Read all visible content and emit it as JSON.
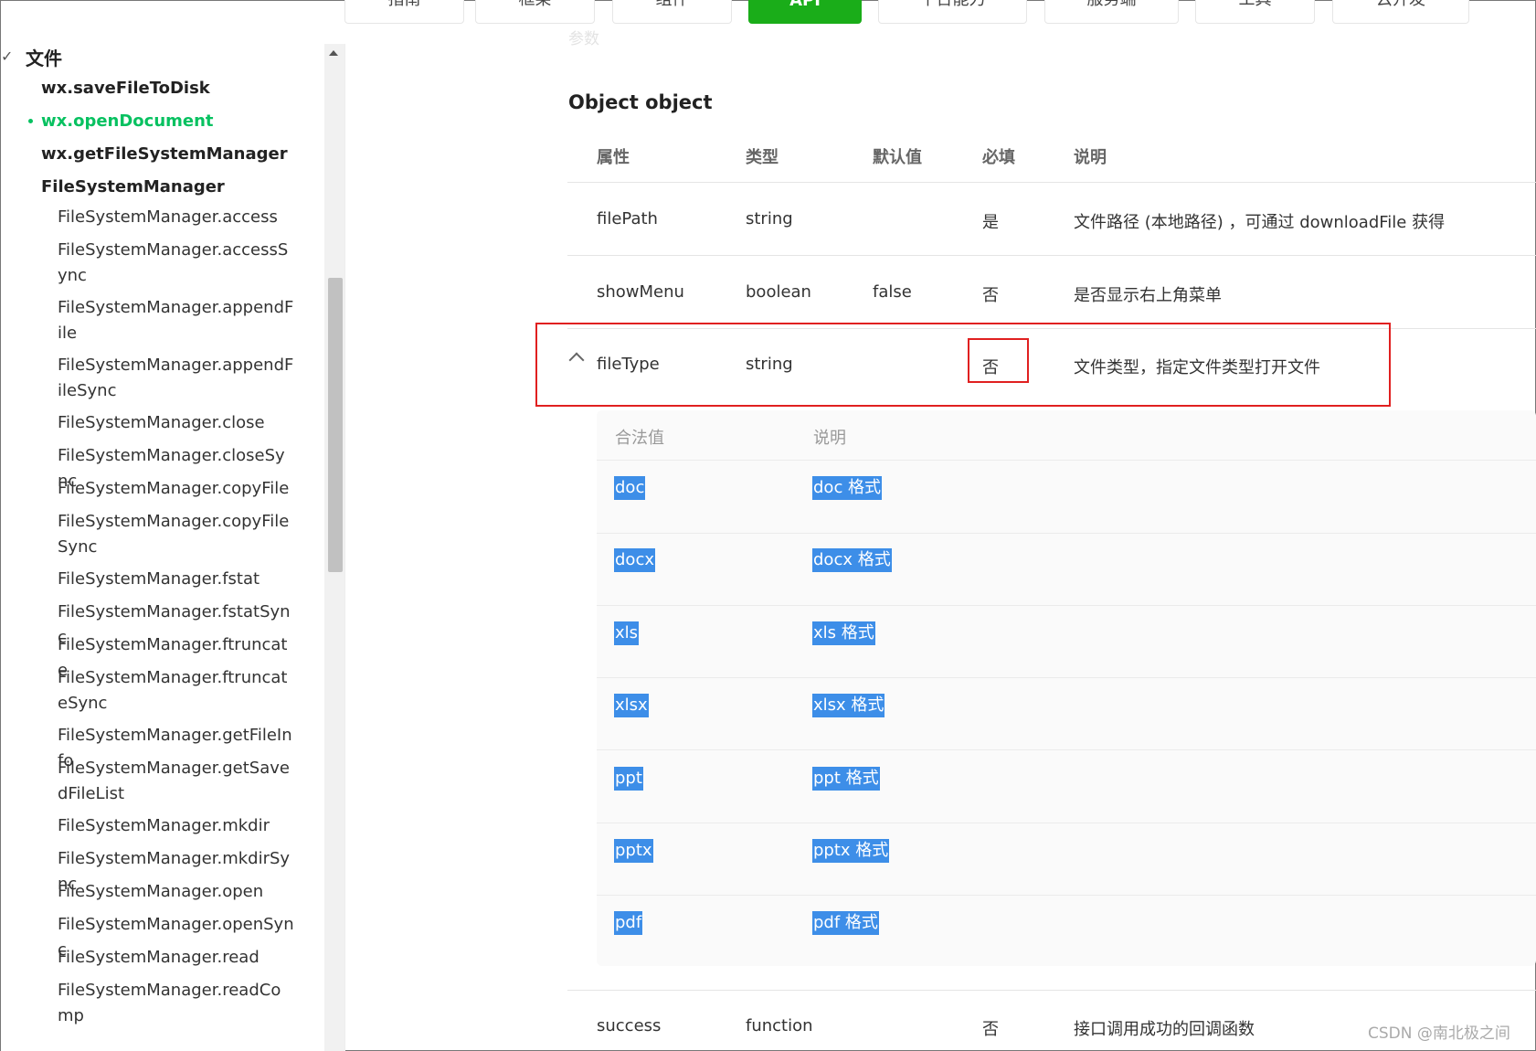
{
  "nav": {
    "tabs": [
      {
        "label": "指南"
      },
      {
        "label": "框架"
      },
      {
        "label": "组件"
      },
      {
        "label": "API",
        "active": true
      },
      {
        "label": "平台能力"
      },
      {
        "label": "服务端"
      },
      {
        "label": "工具"
      },
      {
        "label": "云开发"
      }
    ],
    "ghost_crumb": "参数"
  },
  "sidebar": {
    "section": "文件",
    "items": [
      {
        "label": "wx.saveFileToDisk"
      },
      {
        "label": "wx.openDocument",
        "active": true
      },
      {
        "label": "wx.getFileSystemManager"
      },
      {
        "label": "FileSystemManager"
      }
    ],
    "subitems": [
      "FileSystemManager.access",
      "FileSystemManager.accessSync",
      "FileSystemManager.appendFile",
      "FileSystemManager.appendFileSync",
      "FileSystemManager.close",
      "FileSystemManager.closeSync",
      "FileSystemManager.copyFile",
      "FileSystemManager.copyFileSync",
      "FileSystemManager.fstat",
      "FileSystemManager.fstatSync",
      "FileSystemManager.ftruncate",
      "FileSystemManager.ftruncateSync",
      "FileSystemManager.getFileInfo",
      "FileSystemManager.getSavedFileList",
      "FileSystemManager.mkdir",
      "FileSystemManager.mkdirSync",
      "FileSystemManager.open",
      "FileSystemManager.openSync",
      "FileSystemManager.read",
      "FileSystemManager.readComp"
    ]
  },
  "main": {
    "object_title": "Object object",
    "headers": {
      "prop": "属性",
      "type": "类型",
      "default": "默认值",
      "required": "必填",
      "desc": "说明"
    },
    "rows": [
      {
        "prop": "filePath",
        "type": "string",
        "default": "",
        "required": "是",
        "desc": "文件路径 (本地路径) ，可通过 downloadFile 获得"
      },
      {
        "prop": "showMenu",
        "type": "boolean",
        "default": "false",
        "required": "否",
        "desc": "是否显示右上角菜单"
      },
      {
        "prop": "fileType",
        "type": "string",
        "default": "",
        "required": "否",
        "desc": "文件类型，指定文件类型打开文件"
      },
      {
        "prop": "success",
        "type": "function",
        "default": "",
        "required": "否",
        "desc": "接口调用成功的回调函数"
      }
    ],
    "sub_headers": {
      "value": "合法值",
      "desc": "说明"
    },
    "sub_rows": [
      {
        "value": "doc",
        "desc": "doc 格式"
      },
      {
        "value": "docx",
        "desc": "docx 格式"
      },
      {
        "value": "xls",
        "desc": "xls 格式"
      },
      {
        "value": "xlsx",
        "desc": "xlsx 格式"
      },
      {
        "value": "ppt",
        "desc": "ppt 格式"
      },
      {
        "value": "pptx",
        "desc": "pptx 格式"
      },
      {
        "value": "pdf",
        "desc": "pdf 格式"
      }
    ]
  },
  "colors": {
    "accent": "#07c160",
    "highlight_box": "#e02020",
    "selection": "#3d8ee8"
  },
  "watermark": "CSDN @南北极之间"
}
